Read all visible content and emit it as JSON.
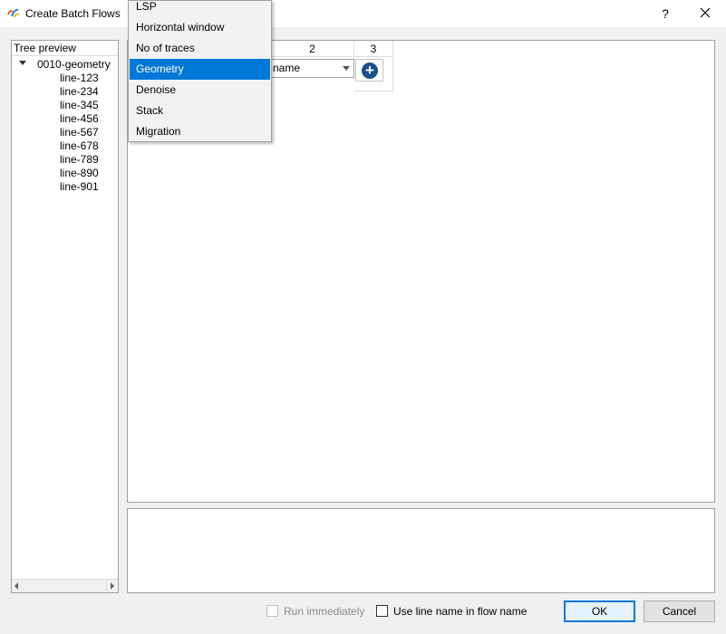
{
  "window": {
    "title": "Create Batch Flows",
    "help_label": "?",
    "icon": "app-icon"
  },
  "tree": {
    "header": "Tree preview",
    "root": "0010-geometry",
    "children": [
      "line-123",
      "line-234",
      "line-345",
      "line-456",
      "line-567",
      "line-678",
      "line-789",
      "line-890",
      "line-901"
    ]
  },
  "table": {
    "column_headers": [
      "2",
      "3"
    ],
    "combo_value": "name",
    "add_icon": "plus-circle-icon"
  },
  "dropdown": {
    "items": [
      "LSP",
      "Horizontal window",
      "No of traces",
      "Geometry",
      "Denoise",
      "Stack",
      "Migration"
    ],
    "selected": "Geometry"
  },
  "footer": {
    "run_immediately_label": "Run immediately",
    "run_immediately_checked": false,
    "run_immediately_enabled": false,
    "use_line_name_label": "Use line name in flow name",
    "use_line_name_checked": false,
    "ok_label": "OK",
    "cancel_label": "Cancel"
  },
  "colors": {
    "selection": "#0078d7",
    "add_button": "#1a4f8b",
    "background": "#f0f0f0"
  }
}
